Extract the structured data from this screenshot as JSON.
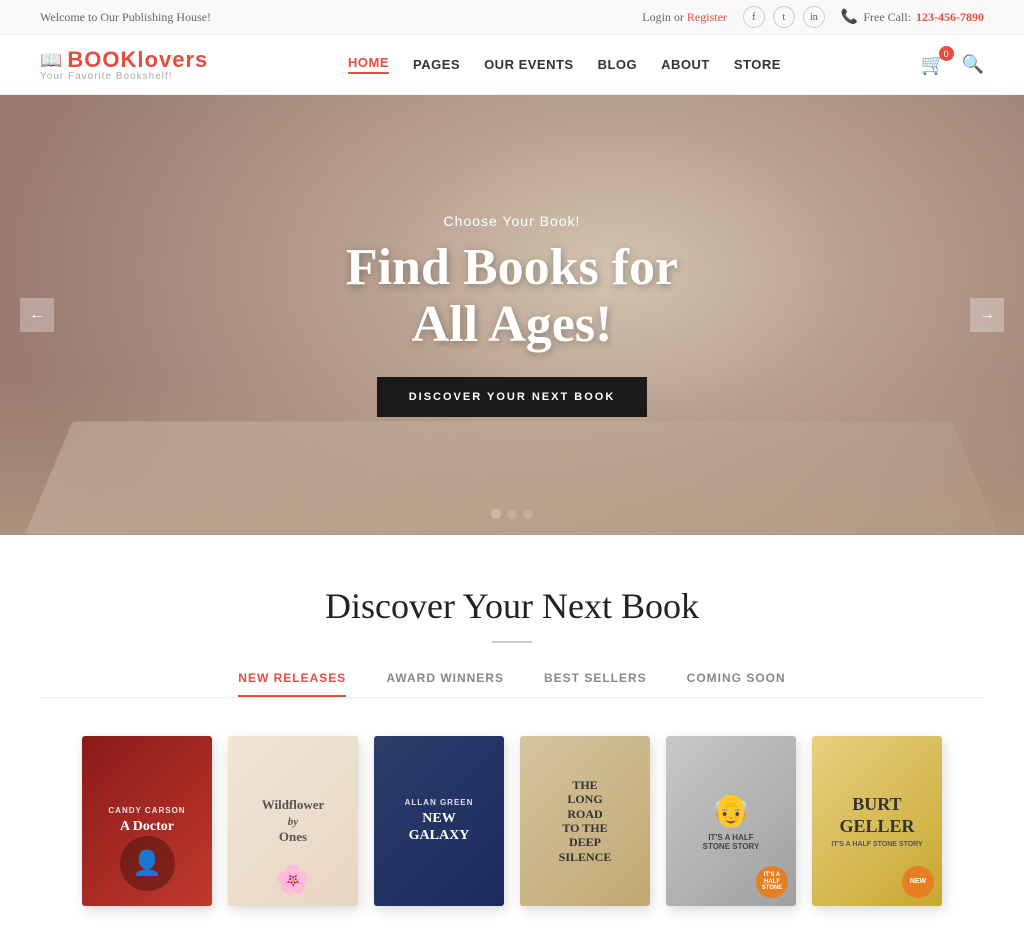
{
  "topbar": {
    "welcome": "Welcome to Our Publishing House!",
    "login": "Login",
    "or": " or ",
    "register": "Register",
    "phone_label": "Free Call:",
    "phone": "123-456-7890",
    "cart_count": "0"
  },
  "header": {
    "logo_part1": "BOOK",
    "logo_part2": "lovers",
    "tagline": "Your Favorite Bookshelf!",
    "nav": [
      {
        "label": "HOME",
        "active": true
      },
      {
        "label": "PAGES",
        "active": false
      },
      {
        "label": "OUR EVENTS",
        "active": false
      },
      {
        "label": "BLOG",
        "active": false
      },
      {
        "label": "ABOUT",
        "active": false
      },
      {
        "label": "STORE",
        "active": false
      }
    ]
  },
  "hero": {
    "sub": "Choose Your Book!",
    "title": "Find Books for\nAll Ages!",
    "cta": "DISCOVER YOUR NEXT BOOK",
    "dots": 3,
    "active_dot": 0
  },
  "section": {
    "title": "Discover Your Next Book",
    "tabs": [
      {
        "label": "NEW RELEASES",
        "active": true
      },
      {
        "label": "AWARD WINNERS",
        "active": false
      },
      {
        "label": "BEST SELLERS",
        "active": false
      },
      {
        "label": "COMING SOON",
        "active": false
      }
    ],
    "books": [
      {
        "author": "CANDY CARSON",
        "title": "A Doctor",
        "cover_class": "book-cover-1",
        "has_badge": false
      },
      {
        "author": "",
        "title": "Wildflower by Ones",
        "cover_class": "book-cover-2",
        "has_badge": false
      },
      {
        "author": "ALLAN GREEN",
        "title": "NEW GALAXY",
        "cover_class": "book-cover-3",
        "has_badge": false
      },
      {
        "author": "",
        "title": "THE LONG ROAD TO THE DEEP SILENCE",
        "cover_class": "book-cover-4",
        "has_badge": false
      },
      {
        "author": "",
        "title": "",
        "cover_class": "book-cover-5",
        "has_badge": true,
        "badge_text": "IT'S A HALF STONE STORY"
      },
      {
        "author": "BURT\nGELLER",
        "title": "IT'S A HALF STONE STORY",
        "cover_class": "book-cover-6",
        "has_badge": true,
        "badge_text": "NEW"
      }
    ]
  },
  "icons": {
    "book": "📖",
    "phone": "📞",
    "facebook": "f",
    "twitter": "t",
    "instagram": "in",
    "cart": "🛒",
    "search": "🔍",
    "arrow_left": "←",
    "arrow_right": "→"
  }
}
